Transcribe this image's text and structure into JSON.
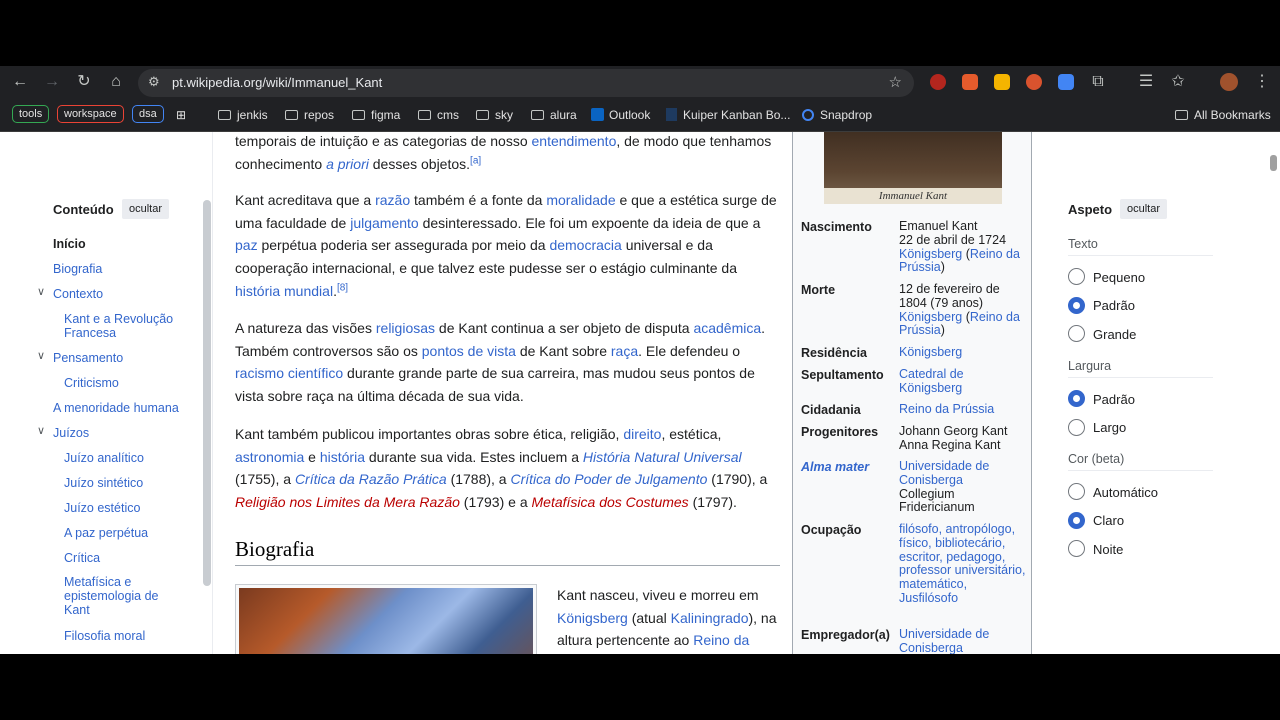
{
  "browser": {
    "url": "pt.wikipedia.org/wiki/Immanuel_Kant",
    "bookmarks_tags": [
      "tools",
      "workspace",
      "dsa"
    ],
    "bookmarks": [
      "jenkis",
      "repos",
      "figma",
      "cms",
      "sky",
      "alura",
      "Outlook",
      "Kuiper Kanban Bo...",
      "Snapdrop"
    ],
    "all_bookmarks": "All Bookmarks"
  },
  "toc": {
    "title": "Conteúdo",
    "hide": "ocultar",
    "items": [
      "Início",
      "Biografia",
      "Contexto",
      "Kant e a Revolução Francesa",
      "Pensamento",
      "Criticismo",
      "A menoridade humana",
      "Juízos",
      "Juízo analítico",
      "Juízo sintético",
      "Juízo estético",
      "A paz perpétua",
      "Crítica",
      "Metafísica e epistemologia de Kant",
      "Filosofia moral"
    ]
  },
  "article": {
    "heading": "Biografia",
    "p1_text": "temporais de intuição e as categorias de nosso",
    "p1_link": "entendimento",
    "p1_rest": ", de modo que tenhamos conhecimento",
    "p1_italic": "a priori",
    "p1_end": "desses objetos.",
    "p1_ref": "[a]",
    "p2_a": "Kant acreditava que a",
    "p2_l1": "razão",
    "p2_b": "também é a fonte da",
    "p2_l2": "moralidade",
    "p2_c": "e que a estética surge de uma faculdade de",
    "p2_l3": "julgamento",
    "p2_d": "desinteressado. Ele foi um expoente da ideia de que a",
    "p2_l4": "paz",
    "p2_e": "perpétua poderia ser assegurada por meio da",
    "p2_l5": "democracia",
    "p2_f": "universal e da cooperação internacional, e que talvez este pudesse ser o estágio culminante da",
    "p2_l6": "história mundial",
    "p2_ref": "[8]",
    "p3_a": "A natureza das visões",
    "p3_l1": "religiosas",
    "p3_b": "de Kant continua a ser objeto de disputa",
    "p3_l2": "acadêmica",
    "p3_c": ". Também controversos são os",
    "p3_l3": "pontos de vista",
    "p3_d": "de Kant sobre",
    "p3_l4": "raça",
    "p3_e": ". Ele defendeu o",
    "p3_l5": "racismo científico",
    "p3_f": "durante grande parte de sua carreira, mas mudou seus pontos de vista sobre raça na última década de sua vida.",
    "p4_a": "Kant também publicou importantes obras sobre ética, religião,",
    "p4_l1": "direito",
    "p4_b": ", estética,",
    "p4_l2": "astronomia",
    "p4_c": "e",
    "p4_l3": "história",
    "p4_d": "durante sua vida. Estes incluem a",
    "p4_l4": "História Natural Universal",
    "p4_e": "(1755), a",
    "p4_l5": "Crítica da Razão Prática",
    "p4_f": "(1788), a",
    "p4_l6": "Crítica do Poder de Julgamento",
    "p4_g": "(1790), a",
    "p4_r1": "Religião nos Limites da Mera Razão",
    "p4_h": "(1793) e a",
    "p4_r2": "Metafísica dos Costumes",
    "p4_i": "(1797).",
    "bio_a": "Kant nasceu, viveu e morreu em",
    "bio_l1": "Königsberg",
    "bio_b": "(atual",
    "bio_l2": "Kaliningrado",
    "bio_c": "), na altura pertencente ao",
    "bio_l3": "Reino da"
  },
  "infobox": {
    "signature": "Immanuel Kant",
    "rows": [
      {
        "label": "Nascimento",
        "value": "Emanuel Kant\n22 de abril de 1724"
      },
      {
        "label": "Morte",
        "value": "12 de fevereiro de\n1804 (79 anos)"
      },
      {
        "label": "Residência",
        "value": "Königsberg"
      },
      {
        "label": "Sepultamento",
        "value": "Catedral de Königsberg"
      },
      {
        "label": "Cidadania",
        "value": "Reino da Prússia"
      },
      {
        "label": "Progenitores",
        "value": "Johann Georg Kant\nAnna Regina Kant"
      },
      {
        "label": "Alma mater",
        "value": "Universidade de Conisberga"
      },
      {
        "label": "Ocupação",
        "value": "filósofo, antropólogo, físico, bibliotecário, escritor, pedagogo, professor universitário, matemático, Jusfilósofo"
      },
      {
        "label": "Empregador(a)",
        "value": "Universidade de Conisberga"
      }
    ],
    "birth_place": "Königsberg",
    "birth_kingdom": "Reino da Prússia",
    "collegium": "Collegium Fridericianum"
  },
  "appearance": {
    "title": "Aspeto",
    "hide": "ocultar",
    "text_label": "Texto",
    "text_options": [
      "Pequeno",
      "Padrão",
      "Grande"
    ],
    "text_selected": "Padrão",
    "width_label": "Largura",
    "width_options": [
      "Padrão",
      "Largo"
    ],
    "width_selected": "Padrão",
    "color_label": "Cor (beta)",
    "color_options": [
      "Automático",
      "Claro",
      "Noite"
    ],
    "color_selected": "Claro"
  }
}
